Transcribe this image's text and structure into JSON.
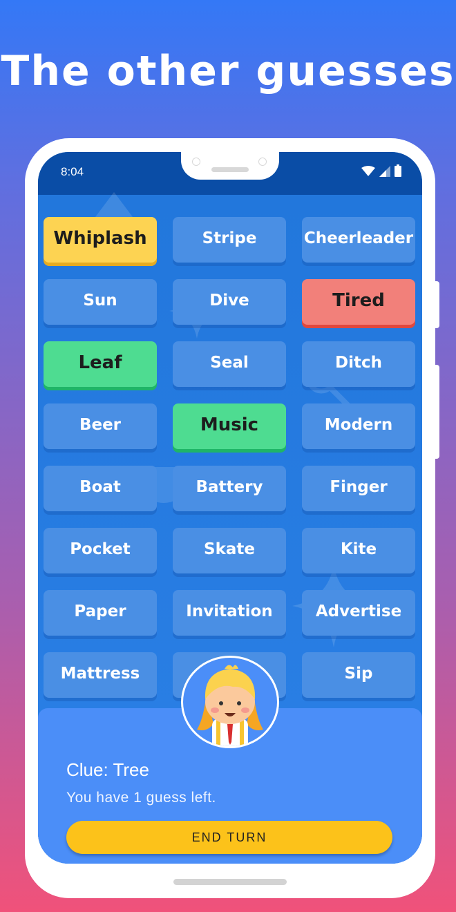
{
  "headline": "The other guesses",
  "status": {
    "time": "8:04"
  },
  "icons": [
    "wifi-icon",
    "signal-icon",
    "battery-icon",
    "search-icon",
    "sparkle-icon",
    "sunglasses-icon"
  ],
  "cards": [
    {
      "word": "Whiplash",
      "state": "yellow"
    },
    {
      "word": "Stripe",
      "state": "blue"
    },
    {
      "word": "Cheerleader",
      "state": "blue"
    },
    {
      "word": "Sun",
      "state": "blue"
    },
    {
      "word": "Dive",
      "state": "blue"
    },
    {
      "word": "Tired",
      "state": "red"
    },
    {
      "word": "Leaf",
      "state": "green"
    },
    {
      "word": "Seal",
      "state": "blue"
    },
    {
      "word": "Ditch",
      "state": "blue"
    },
    {
      "word": "Beer",
      "state": "blue"
    },
    {
      "word": "Music",
      "state": "green"
    },
    {
      "word": "Modern",
      "state": "blue"
    },
    {
      "word": "Boat",
      "state": "blue"
    },
    {
      "word": "Battery",
      "state": "blue"
    },
    {
      "word": "Finger",
      "state": "blue"
    },
    {
      "word": "Pocket",
      "state": "blue"
    },
    {
      "word": "Skate",
      "state": "blue"
    },
    {
      "word": "Kite",
      "state": "blue"
    },
    {
      "word": "Paper",
      "state": "blue"
    },
    {
      "word": "Invitation",
      "state": "blue"
    },
    {
      "word": "Advertise",
      "state": "blue"
    },
    {
      "word": "Mattress",
      "state": "blue"
    },
    {
      "word": "",
      "state": "blue"
    },
    {
      "word": "Sip",
      "state": "blue"
    }
  ],
  "panel": {
    "clue": "Clue: Tree",
    "guesses_left": "You have 1 guess left.",
    "end_turn_label": "END TURN"
  },
  "colors": {
    "yellow": "#fdd352",
    "red": "#f2807a",
    "green": "#4edc91",
    "blue": "#4a8fe4",
    "button": "#fcc21a"
  }
}
